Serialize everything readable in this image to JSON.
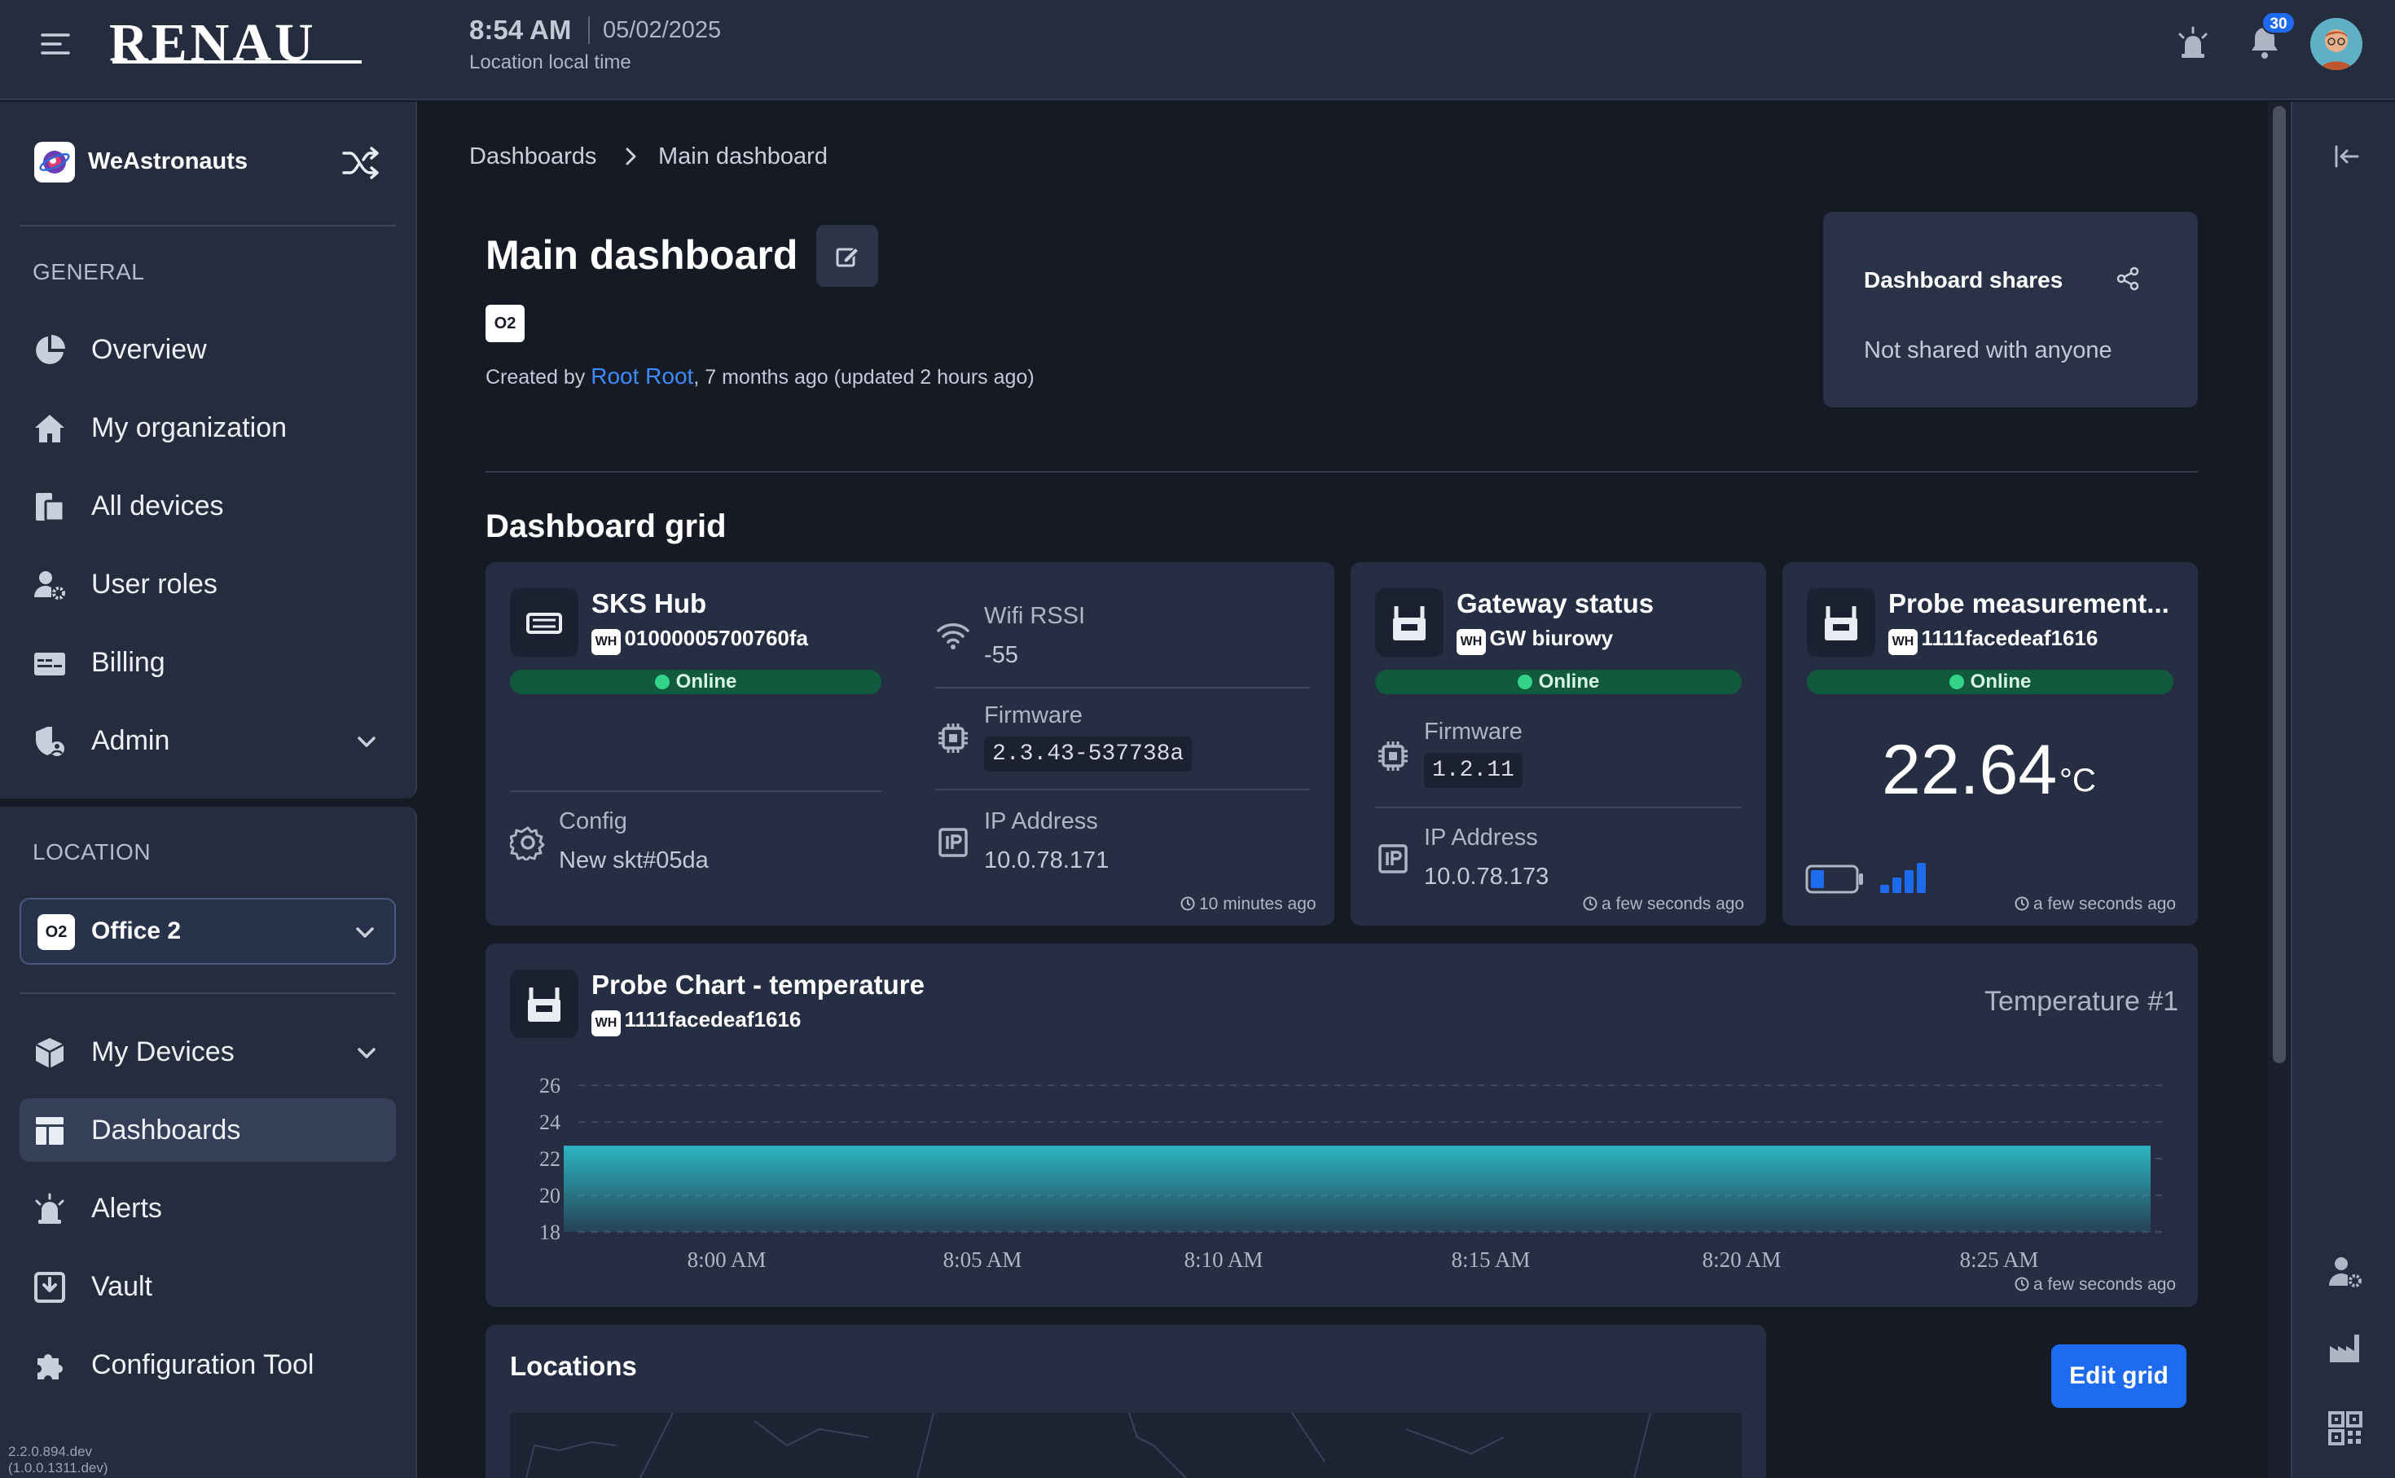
{
  "topbar": {
    "logo": "RENAU",
    "time": "8:54 AM",
    "date": "05/02/2025",
    "time_caption": "Location local time",
    "notifications_count": "30"
  },
  "sidebar": {
    "org_name": "WeAstronauts",
    "general_label": "GENERAL",
    "general_items": [
      {
        "label": "Overview",
        "icon": "pie-chart-icon"
      },
      {
        "label": "My organization",
        "icon": "home-icon"
      },
      {
        "label": "All devices",
        "icon": "devices-icon"
      },
      {
        "label": "User roles",
        "icon": "user-cog-icon"
      },
      {
        "label": "Billing",
        "icon": "billing-icon"
      },
      {
        "label": "Admin",
        "icon": "admin-shield-icon"
      }
    ],
    "location_label": "LOCATION",
    "location": {
      "tag": "O2",
      "name": "Office 2"
    },
    "location_items": [
      {
        "label": "My Devices",
        "icon": "cube-icon"
      },
      {
        "label": "Dashboards",
        "icon": "dashboard-icon"
      },
      {
        "label": "Alerts",
        "icon": "alarm-icon"
      },
      {
        "label": "Vault",
        "icon": "vault-icon"
      },
      {
        "label": "Configuration Tool",
        "icon": "puzzle-icon"
      }
    ],
    "version_line1": "2.2.0.894.dev",
    "version_line2": "(1.0.0.1311.dev)"
  },
  "breadcrumb": {
    "parent": "Dashboards",
    "current": "Main dashboard"
  },
  "page": {
    "title": "Main dashboard",
    "tag": "O2",
    "created_prefix": "Created by ",
    "author": "Root Root",
    "created_suffix": ", 7 months ago (updated 2 hours ago)"
  },
  "shares": {
    "title": "Dashboard shares",
    "status": "Not shared with anyone"
  },
  "grid": {
    "title": "Dashboard grid",
    "wh_badge": "WH",
    "sks_hub": {
      "title": "SKS Hub",
      "serial": "01000005700760fa",
      "status": "Online",
      "wifi_label": "Wifi RSSI",
      "wifi_value": "-55",
      "firmware_label": "Firmware",
      "firmware_value": "2.3.43-537738a",
      "config_label": "Config",
      "config_value": "New skt#05da",
      "ip_label": "IP Address",
      "ip_value": "10.0.78.171",
      "updated": "10 minutes ago"
    },
    "gateway": {
      "title": "Gateway status",
      "serial": "GW biurowy",
      "status": "Online",
      "firmware_label": "Firmware",
      "firmware_value": "1.2.11",
      "ip_label": "IP Address",
      "ip_value": "10.0.78.173",
      "updated": "a few seconds ago"
    },
    "probe": {
      "title": "Probe measurement...",
      "serial": "1111facedeaf1616",
      "status": "Online",
      "temperature": "22.64",
      "unit": "°C",
      "battery_level": 0.3,
      "signal_bars": 4,
      "updated": "a few seconds ago"
    },
    "chart_card": {
      "title": "Probe Chart - temperature",
      "serial": "1111facedeaf1616",
      "updated": "a few seconds ago"
    },
    "locations_title": "Locations",
    "edit_button": "Edit grid"
  },
  "chart_data": {
    "type": "area",
    "title": "Probe Chart - temperature",
    "series": [
      {
        "name": "Temperature #1",
        "x": [
          "7:55 AM",
          "8:30 AM"
        ],
        "values": [
          22.64,
          22.64
        ]
      }
    ],
    "x_tick_labels": [
      "8:00 AM",
      "8:05 AM",
      "8:10 AM",
      "8:15 AM",
      "8:20 AM",
      "8:25 AM"
    ],
    "y_ticks": [
      26,
      24,
      22,
      20,
      18
    ],
    "ylim": [
      18,
      26
    ],
    "grid": "horizontal dashed",
    "legend": "top-right",
    "fill_color": "#2bb3bf"
  },
  "colors": {
    "accent": "#1e6bf0",
    "online": "#33d487",
    "link": "#3d8bff"
  }
}
